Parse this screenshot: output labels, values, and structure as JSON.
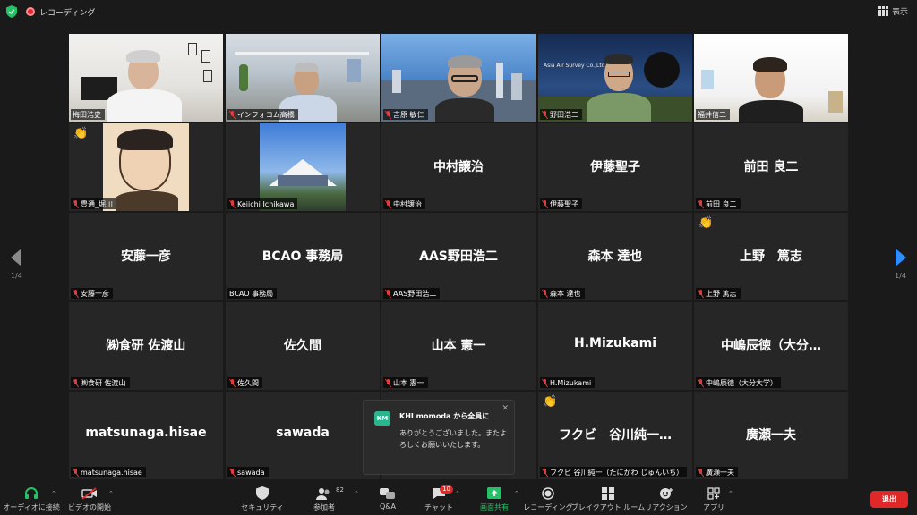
{
  "topbar": {
    "recording_label": "レコーディング",
    "view_label": "表示"
  },
  "pagination": {
    "left": "1/4",
    "right": "1/4"
  },
  "participants": [
    {
      "display": "",
      "tag": "梅田浩史",
      "muted": false,
      "hand": false
    },
    {
      "display": "",
      "tag": "インフォコム高橋",
      "muted": true,
      "hand": false
    },
    {
      "display": "",
      "tag": "吉原 敏仁",
      "muted": true,
      "hand": false
    },
    {
      "display": "",
      "tag": "野田浩二",
      "muted": true,
      "hand": false
    },
    {
      "display": "",
      "tag": "福井信二",
      "muted": false,
      "hand": false
    },
    {
      "display": "",
      "tag": "豊通_堀川",
      "muted": true,
      "hand": true
    },
    {
      "display": "",
      "tag": "Keiichi Ichikawa",
      "muted": true,
      "hand": false
    },
    {
      "display": "中村譲治",
      "tag": "中村譲治",
      "muted": true,
      "hand": false
    },
    {
      "display": "伊藤聖子",
      "tag": "伊藤聖子",
      "muted": true,
      "hand": false
    },
    {
      "display": "前田 良二",
      "tag": "前田 良二",
      "muted": true,
      "hand": false
    },
    {
      "display": "安藤一彦",
      "tag": "安藤一彦",
      "muted": true,
      "hand": false
    },
    {
      "display": "BCAO 事務局",
      "tag": "BCAO 事務局",
      "muted": false,
      "hand": false
    },
    {
      "display": "AAS野田浩二",
      "tag": "AAS野田浩二",
      "muted": true,
      "hand": false
    },
    {
      "display": "森本 達也",
      "tag": "森本 達也",
      "muted": true,
      "hand": false
    },
    {
      "display": "上野　篤志",
      "tag": "上野 篤志",
      "muted": true,
      "hand": true
    },
    {
      "display": "㈱食研 佐渡山",
      "tag": "㈱食研 佐渡山",
      "muted": true,
      "hand": false
    },
    {
      "display": "佐久間",
      "tag": "佐久間",
      "muted": true,
      "hand": false
    },
    {
      "display": "山本 憲一",
      "tag": "山本 憲一",
      "muted": true,
      "hand": false
    },
    {
      "display": "H.Mizukami",
      "tag": "H.Mizukami",
      "muted": true,
      "hand": false
    },
    {
      "display": "中嶋辰徳（大分…",
      "tag": "中嶋辰徳（大分大学）",
      "muted": true,
      "hand": false
    },
    {
      "display": "matsunaga.hisae",
      "tag": "matsunaga.hisae",
      "muted": true,
      "hand": false
    },
    {
      "display": "sawada",
      "tag": "sawada",
      "muted": true,
      "hand": false
    },
    {
      "display": "",
      "tag": "",
      "muted": false,
      "hand": false
    },
    {
      "display": "フクビ　谷川純一…",
      "tag": "フクビ 谷川純一（たにかわ じゅんいち）",
      "muted": true,
      "hand": true
    },
    {
      "display": "廣瀬一夫",
      "tag": "廣瀬一夫",
      "muted": true,
      "hand": false
    }
  ],
  "video_labels": {
    "plane_tile_text": "Asia Air Survey Co.,Ltd."
  },
  "chat": {
    "avatar": "KM",
    "from": "KHI momoda から全員に",
    "message": "ありがとうございました。またよろしくお願いいたします。"
  },
  "toolbar": {
    "audio": "オーディオに接続",
    "video": "ビデオの開始",
    "security": "セキュリティ",
    "participants": "参加者",
    "participants_count": "82",
    "qa": "Q&A",
    "chat": "チャット",
    "chat_badge": "10",
    "share": "画面共有",
    "record": "レコーディング",
    "breakout": "ブレイクアウト ルーム",
    "reactions": "リアクション",
    "apps": "アプリ",
    "leave": "退出"
  },
  "colors": {
    "accent": "#2d8cff",
    "leave": "#e02828",
    "active_speaker": "#a6e22e",
    "share_green": "#23c265"
  }
}
